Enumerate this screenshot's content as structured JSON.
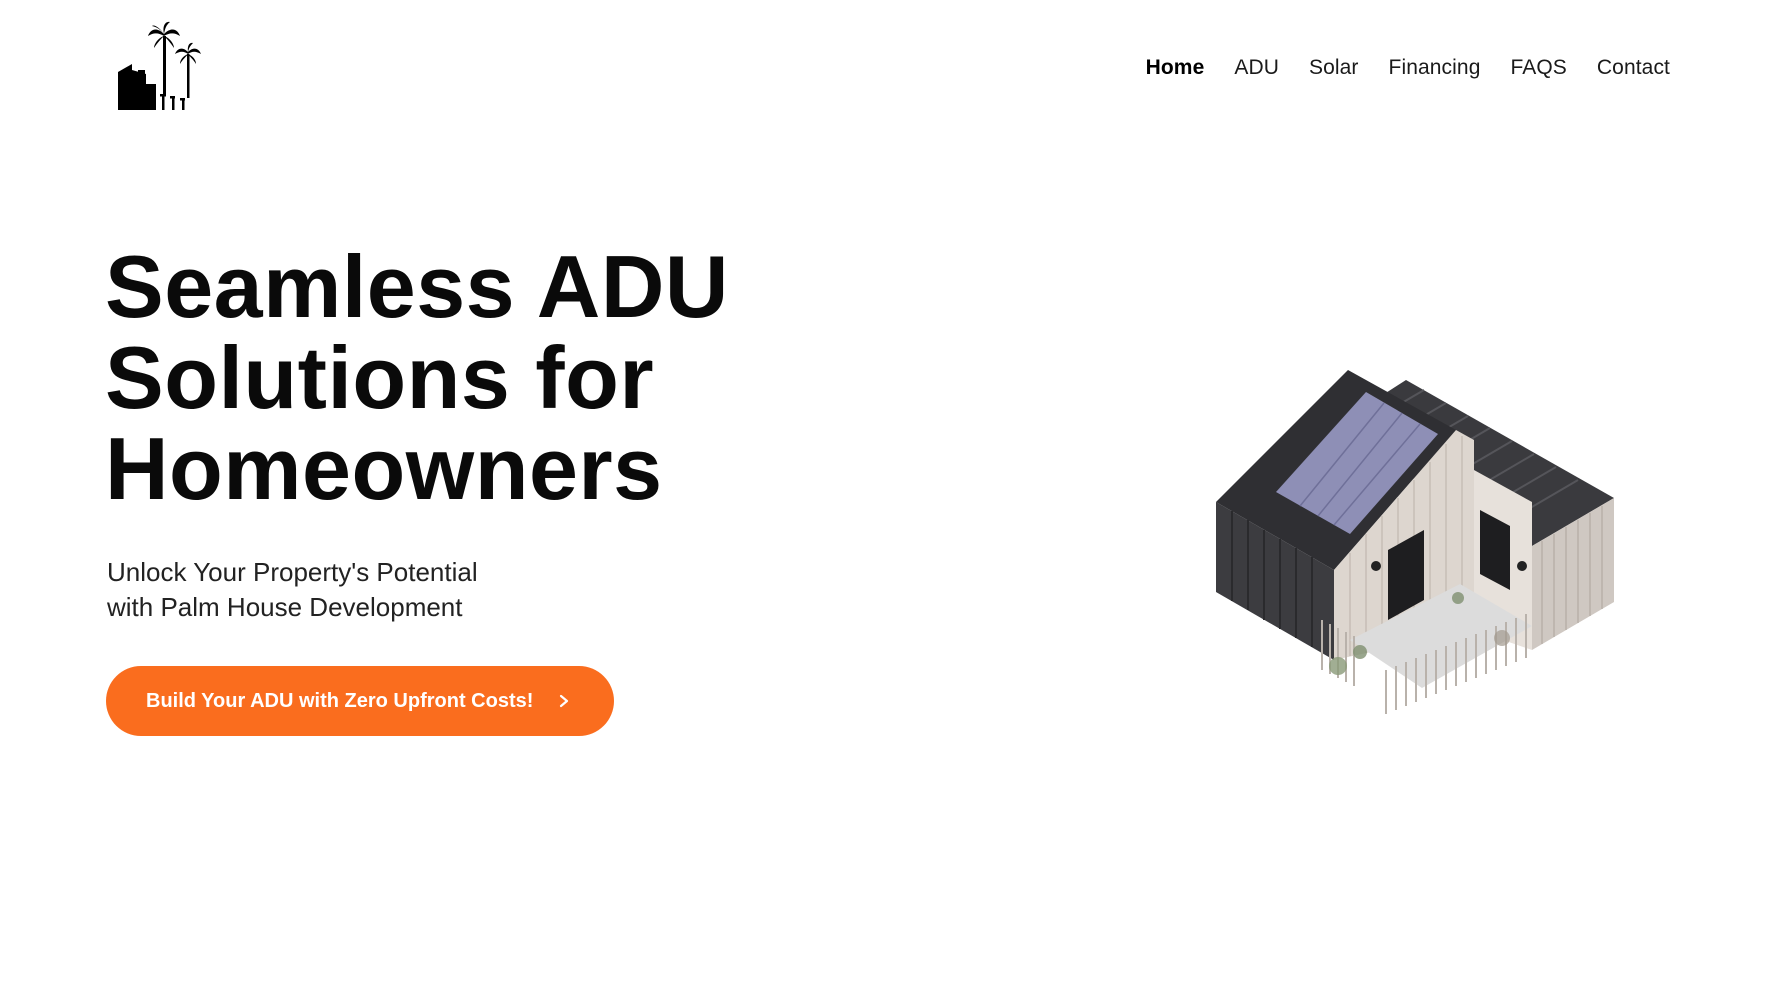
{
  "brand": {
    "logo_icon": "palm-house-logo-icon"
  },
  "nav": {
    "items": [
      {
        "label": "Home",
        "active": true
      },
      {
        "label": "ADU",
        "active": false
      },
      {
        "label": "Solar",
        "active": false
      },
      {
        "label": "Financing",
        "active": false
      },
      {
        "label": "FAQS",
        "active": false
      },
      {
        "label": "Contact",
        "active": false
      }
    ]
  },
  "hero": {
    "title_lines": [
      "Seamless ADU",
      "Solutions for",
      "Homeowners"
    ],
    "subtitle_lines": [
      "Unlock Your Property's Potential",
      "with Palm House Development"
    ],
    "cta_label": "Build Your ADU with Zero Upfront Costs!",
    "cta_icon": "chevron-right-icon",
    "image_icon": "adu-house-illustration"
  },
  "colors": {
    "accent": "#fa6d1e",
    "text": "#0a0a0a",
    "background": "#ffffff"
  }
}
